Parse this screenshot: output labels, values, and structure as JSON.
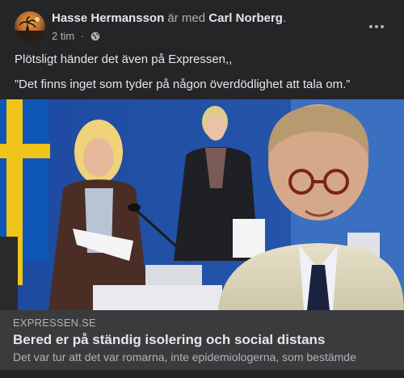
{
  "post": {
    "author": "Hasse Hermansson",
    "with_text": " är med ",
    "tagged": "Carl Norberg",
    "tagged_suffix": ".",
    "time": "2 tim",
    "time_sep": " · ",
    "privacy_icon": "globe-icon",
    "more_icon": "more-dots-icon",
    "body_line1": "Plötsligt händer det även på Expressen,,",
    "body_line2": "”Det finns inget som tyder på någon överdödlighet att tala om.”"
  },
  "link": {
    "domain": "EXPRESSEN.SE",
    "title": "Bered er på ständig isolering och social distans",
    "description": "Det var tur att det var romarna, inte epidemiologerna, som bestämde"
  },
  "colors": {
    "background": "#242526",
    "link_box": "#3a3b3c",
    "text_primary": "#e4e6eb",
    "text_secondary": "#b0b3b8"
  }
}
